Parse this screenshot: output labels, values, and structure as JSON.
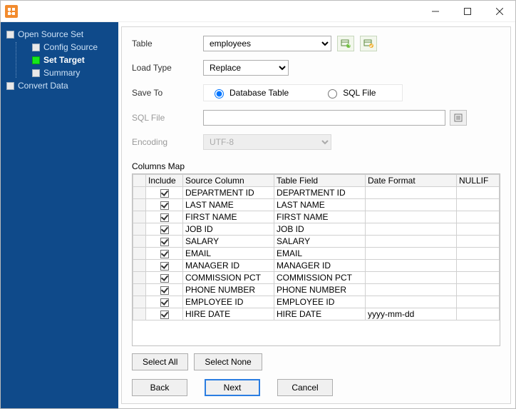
{
  "sidebar": {
    "root": "Open Source Set",
    "items": [
      {
        "label": "Config Source",
        "active": false
      },
      {
        "label": "Set Target",
        "active": true
      },
      {
        "label": "Summary",
        "active": false
      }
    ],
    "root2": "Convert Data"
  },
  "form": {
    "table_label": "Table",
    "table_value": "employees",
    "load_label": "Load Type",
    "load_value": "Replace",
    "saveto_label": "Save To",
    "saveto_opt1": "Database Table",
    "saveto_opt2": "SQL File",
    "sqlfile_label": "SQL File",
    "sqlfile_value": "",
    "encoding_label": "Encoding",
    "encoding_value": "UTF-8",
    "columns_map_label": "Columns Map"
  },
  "grid": {
    "headers": {
      "include": "Include",
      "source": "Source Column",
      "field": "Table Field",
      "datefmt": "Date Format",
      "nullif": "NULLIF"
    },
    "rows": [
      {
        "include": true,
        "source": "DEPARTMENT ID",
        "field": "DEPARTMENT ID",
        "datefmt": "",
        "nullif": ""
      },
      {
        "include": true,
        "source": "LAST NAME",
        "field": "LAST NAME",
        "datefmt": "",
        "nullif": ""
      },
      {
        "include": true,
        "source": "FIRST NAME",
        "field": "FIRST NAME",
        "datefmt": "",
        "nullif": ""
      },
      {
        "include": true,
        "source": "JOB ID",
        "field": "JOB ID",
        "datefmt": "",
        "nullif": ""
      },
      {
        "include": true,
        "source": "SALARY",
        "field": "SALARY",
        "datefmt": "",
        "nullif": ""
      },
      {
        "include": true,
        "source": "EMAIL",
        "field": "EMAIL",
        "datefmt": "",
        "nullif": ""
      },
      {
        "include": true,
        "source": "MANAGER ID",
        "field": "MANAGER ID",
        "datefmt": "",
        "nullif": ""
      },
      {
        "include": true,
        "source": "COMMISSION PCT",
        "field": "COMMISSION PCT",
        "datefmt": "",
        "nullif": ""
      },
      {
        "include": true,
        "source": "PHONE NUMBER",
        "field": "PHONE NUMBER",
        "datefmt": "",
        "nullif": ""
      },
      {
        "include": true,
        "source": "EMPLOYEE ID",
        "field": "EMPLOYEE ID",
        "datefmt": "",
        "nullif": ""
      },
      {
        "include": true,
        "source": "HIRE DATE",
        "field": "HIRE DATE",
        "datefmt": "yyyy-mm-dd",
        "nullif": ""
      }
    ]
  },
  "buttons": {
    "select_all": "Select All",
    "select_none": "Select None",
    "back": "Back",
    "next": "Next",
    "cancel": "Cancel"
  }
}
